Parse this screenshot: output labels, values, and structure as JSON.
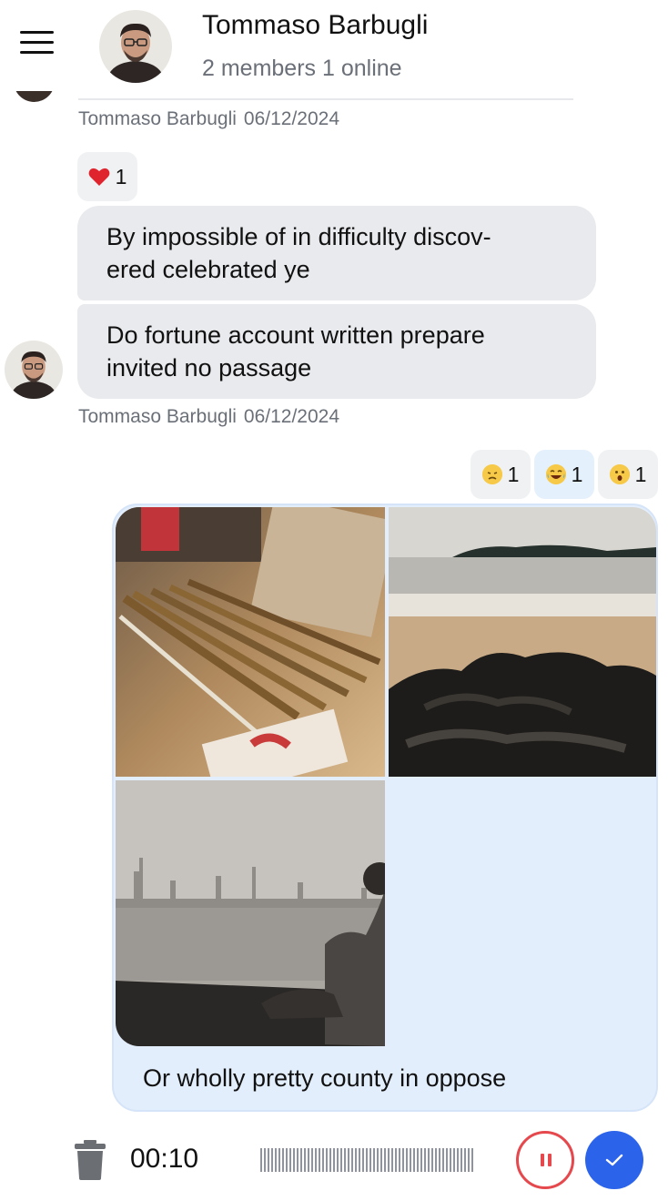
{
  "header": {
    "title": "Tommaso Barbugli",
    "subtitle": "2 members 1 online",
    "menu_icon": "hamburger-menu-icon",
    "avatar_icon": "user-avatar"
  },
  "messages": [
    {
      "author": "Tommaso Barbugli",
      "date": "06/12/2024"
    },
    {
      "reactions": [
        {
          "emoji": "heart",
          "count": "1"
        }
      ],
      "bubbles": [
        "By impossible of in difficulty discov-\nered celebrated ye",
        "Do fortune account written prepare\ninvited no passage"
      ],
      "author": "Tommaso Barbugli",
      "date": "06/12/2024"
    },
    {
      "reactions": [
        {
          "emoji": "disappointed-face",
          "count": "1"
        },
        {
          "emoji": "tears-of-joy-face",
          "count": "1",
          "active": true
        },
        {
          "emoji": "surprised-face",
          "count": "1"
        }
      ],
      "images": [
        "desk-pencils-photo",
        "rocky-beach-photo",
        "person-by-sea-photo"
      ],
      "caption": "Or wholly pretty county in oppose"
    }
  ],
  "recorder": {
    "time": "00:10",
    "delete_icon": "trash-icon",
    "pause_icon": "pause-icon",
    "send_icon": "checkmark-icon"
  },
  "colors": {
    "accent": "#2b63ea",
    "recording_red": "#e5484d",
    "bubble_gray": "#e9eaed",
    "own_bubble": "#e3eefc",
    "meta_gray": "#6b7078"
  }
}
